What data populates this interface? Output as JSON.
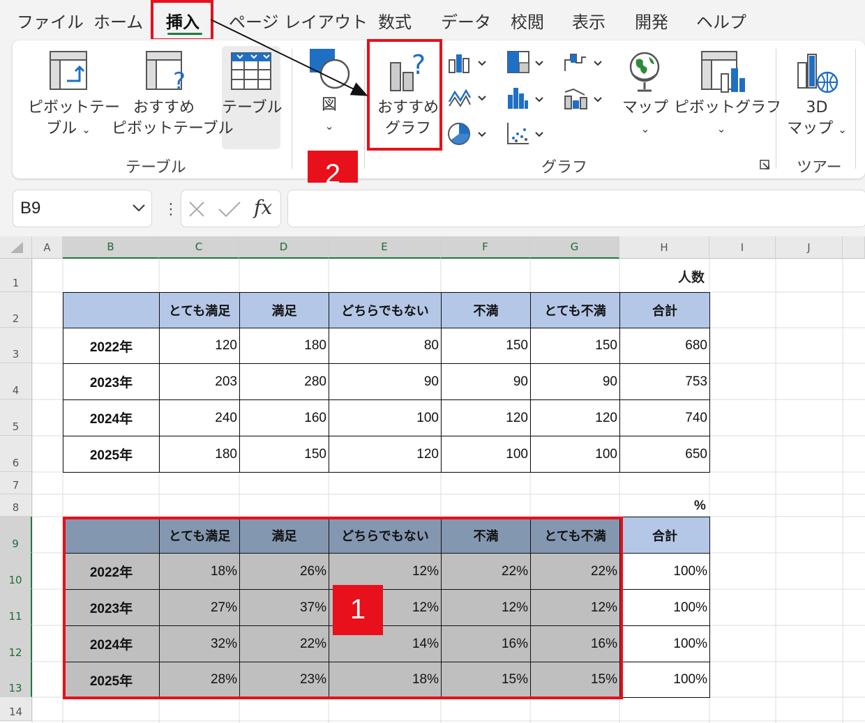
{
  "ribbon": {
    "tabs": [
      "ファイル",
      "ホーム",
      "挿入",
      "ページ レイアウト",
      "数式",
      "データ",
      "校閲",
      "表示",
      "開発",
      "ヘルプ"
    ],
    "active_tab": "挿入",
    "buttons": {
      "pivot_table_line1": "ピボットテー",
      "pivot_table_line2": "ブル",
      "rec_pivot_line1": "おすすめ",
      "rec_pivot_line2": "ピボットテーブル",
      "table": "テーブル",
      "shapes": "図",
      "rec_charts_line1": "おすすめ",
      "rec_charts_line2": "グラフ",
      "map": "マップ",
      "pivot_chart": "ピボットグラフ",
      "map3d_line1": "3D",
      "map3d_line2": "マップ"
    },
    "groups": {
      "tables": "テーブル",
      "charts": "グラフ",
      "tours": "ツアー"
    }
  },
  "annotations": {
    "step1": "1",
    "step2": "2"
  },
  "formula_bar": {
    "name_box": "B9",
    "fx": "fx",
    "formula": ""
  },
  "columns": [
    "A",
    "B",
    "C",
    "D",
    "E",
    "F",
    "G",
    "H",
    "I",
    "J"
  ],
  "rows": [
    "1",
    "2",
    "3",
    "4",
    "5",
    "6",
    "7",
    "8",
    "9",
    "10",
    "11",
    "12",
    "13",
    "14"
  ],
  "sheet": {
    "unit_people": "人数",
    "unit_percent": "%",
    "headers": [
      "",
      "とても満足",
      "満足",
      "どちらでもない",
      "不満",
      "とても不満",
      "合計"
    ],
    "count_table": [
      [
        "2022年",
        "120",
        "180",
        "80",
        "150",
        "150",
        "680"
      ],
      [
        "2023年",
        "203",
        "280",
        "90",
        "90",
        "90",
        "753"
      ],
      [
        "2024年",
        "240",
        "160",
        "100",
        "120",
        "120",
        "740"
      ],
      [
        "2025年",
        "180",
        "150",
        "120",
        "100",
        "100",
        "650"
      ]
    ],
    "percent_table": [
      [
        "2022年",
        "18%",
        "26%",
        "12%",
        "22%",
        "22%",
        "100%"
      ],
      [
        "2023年",
        "27%",
        "37%",
        "12%",
        "12%",
        "12%",
        "100%"
      ],
      [
        "2024年",
        "32%",
        "22%",
        "14%",
        "16%",
        "16%",
        "100%"
      ],
      [
        "2025年",
        "28%",
        "23%",
        "18%",
        "15%",
        "15%",
        "100%"
      ]
    ]
  },
  "colors": {
    "header_fill": "#b4c7e7",
    "selected_header_fill": "#8497b0",
    "selected_fill": "#bfbfbf",
    "highlight_red": "#e8101a",
    "excel_green": "#1e7a3e"
  }
}
